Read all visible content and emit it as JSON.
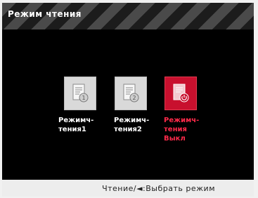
{
  "window": {
    "title": "Режим чтения"
  },
  "modes": [
    {
      "label": "Режимч-\nтения1",
      "icon": "document-1-icon",
      "badge": "1",
      "selected": false
    },
    {
      "label": "Режимч-\nтения2",
      "icon": "document-2-icon",
      "badge": "2",
      "selected": false
    },
    {
      "label": "Режимч-\nтения\nВыкл",
      "icon": "document-power-icon",
      "selected": true
    }
  ],
  "status": {
    "hint": "Чтение/◄:Выбрать режим"
  },
  "colors": {
    "selected": "#c8102e",
    "selected_text": "#ff2a4a",
    "tile": "#d9d9d9"
  }
}
